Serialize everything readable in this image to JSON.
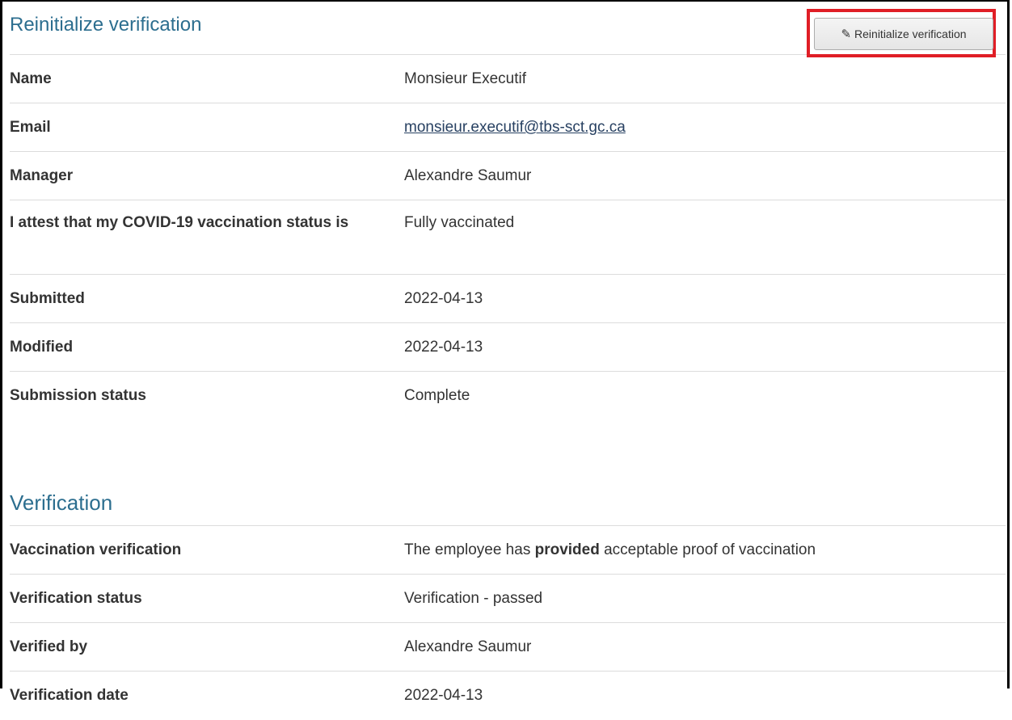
{
  "section1": {
    "title": "Reinitialize verification",
    "button_label": "Reinitialize verification",
    "button_icon": "pencil-icon",
    "rows": [
      {
        "label": "Name",
        "value": "Monsieur Executif"
      },
      {
        "label": "Email",
        "value": "monsieur.executif@tbs-sct.gc.ca"
      },
      {
        "label": "Manager",
        "value": "Alexandre Saumur"
      },
      {
        "label": "I attest that my COVID-19 vaccination status is",
        "value": "Fully vaccinated"
      },
      {
        "label": "Submitted",
        "value": "2022-04-13"
      },
      {
        "label": "Modified",
        "value": "2022-04-13"
      },
      {
        "label": "Submission status",
        "value": "Complete"
      }
    ]
  },
  "section2": {
    "title": "Verification",
    "vaccination": {
      "label": "Vaccination verification",
      "value_before": "The employee has ",
      "value_bold": "provided",
      "value_after": " acceptable proof of vaccination"
    },
    "rows": [
      {
        "label": "Verification status",
        "value": "Verification - passed"
      },
      {
        "label": "Verified by",
        "value": "Alexandre Saumur"
      },
      {
        "label": "Verification date",
        "value": "2022-04-13"
      }
    ]
  },
  "colors": {
    "heading": "#2c6e8f",
    "highlight": "#e01e26",
    "link": "#284162"
  }
}
